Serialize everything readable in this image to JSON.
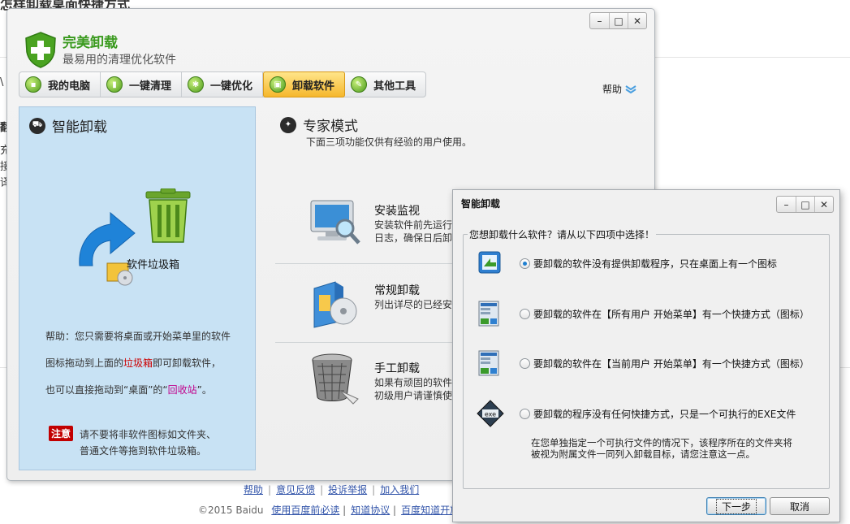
{
  "background": {
    "title": "怎样卸载桌面快捷方式",
    "fragments": [
      "\\",
      "翻",
      "充",
      "接",
      "译"
    ],
    "footer_links": [
      "帮助",
      "意见反馈",
      "投诉举报",
      "加入我们"
    ],
    "copyright": "©2015 Baidu",
    "footer_links2": [
      "使用百度前必读",
      "知道协议",
      "百度知道开放平"
    ]
  },
  "main_window": {
    "app_name": "完美卸载",
    "slogan": "最易用的清理优化软件",
    "controls": [
      "–",
      "□",
      "✕"
    ],
    "tabs": [
      {
        "label": "我的电脑",
        "icon": "computer-icon",
        "active": false
      },
      {
        "label": "一键清理",
        "icon": "broom-icon",
        "active": false
      },
      {
        "label": "一键优化",
        "icon": "gears-icon",
        "active": false
      },
      {
        "label": "卸载软件",
        "icon": "uninstall-icon",
        "active": true
      },
      {
        "label": "其他工具",
        "icon": "tools-icon",
        "active": false
      }
    ],
    "help": "帮助",
    "smart": {
      "title": "智能卸载",
      "trash_label": "软件垃圾箱",
      "help_line1": "帮助：您只需要将桌面或开始菜单里的软件",
      "help_line2_a": "图标拖动到上面的",
      "help_line2_hl": "垃圾箱",
      "help_line2_b": "即可卸载软件，",
      "help_line3_a": "也可以直接拖动到“桌面”的“",
      "help_line3_hl": "回收站",
      "help_line3_b": "”。",
      "notice_badge": "注意",
      "notice_line1": "请不要将非软件图标如文件夹、",
      "notice_line2": "普通文件等拖到软件垃圾箱。"
    },
    "expert": {
      "title": "专家模式",
      "subtitle": "下面三项功能仅供有经验的用户使用。",
      "features": [
        {
          "title": "安装监视",
          "desc1": "安装软件前先运行",
          "desc2": "日志，确保日后卸载"
        },
        {
          "title": "常规卸载",
          "desc1": "列出详尽的已经安",
          "desc2": ""
        },
        {
          "title": "手工卸载",
          "desc1": "如果有顽固的软件",
          "desc2": "初级用户请谨慎使"
        }
      ]
    }
  },
  "dialog": {
    "title": "智能卸载",
    "controls": [
      "–",
      "□",
      "✕"
    ],
    "legend": "您想卸载什么软件？请从以下四项中选择！",
    "options": [
      {
        "label": "要卸载的软件没有提供卸载程序，只在桌面上有一个图标",
        "selected": true,
        "icon": "desktop-shortcut-icon"
      },
      {
        "label": "要卸载的软件在【所有用户 开始菜单】有一个快捷方式（图标）",
        "selected": false,
        "icon": "all-users-start-menu-icon"
      },
      {
        "label": "要卸载的软件在【当前用户 开始菜单】有一个快捷方式（图标）",
        "selected": false,
        "icon": "current-user-start-menu-icon"
      },
      {
        "label": "要卸载的程序没有任何快捷方式，只是一个可执行的EXE文件",
        "selected": false,
        "icon": "exe-file-icon"
      }
    ],
    "note_line1": "在您单独指定一个可执行文件的情况下，该程序所在的文件夹将",
    "note_line2": "被视为附属文件一同列入卸载目标，请您注意这一点。",
    "next_button": "下一步",
    "cancel_button": "取消"
  }
}
